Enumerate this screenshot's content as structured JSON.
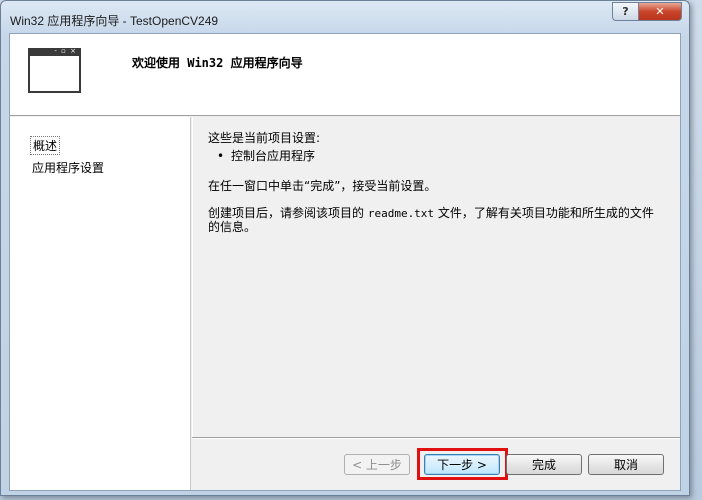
{
  "window": {
    "title": "Win32 应用程序向导 - TestOpenCV249",
    "help_label": "?",
    "close_label": "✕"
  },
  "banner": {
    "title": "欢迎使用 Win32 应用程序向导",
    "icon": "window-icon"
  },
  "nav": {
    "items": [
      {
        "label": "概述"
      },
      {
        "label": "应用程序设置"
      }
    ]
  },
  "content": {
    "intro": "这些是当前项目设置:",
    "bullet": "控制台应用程序",
    "finish_hint": "在任一窗口中单击“完成”，接受当前设置。",
    "readme_before": "创建项目后，请参阅该项目的 ",
    "readme_file": "readme.txt",
    "readme_after": " 文件，了解有关项目功能和所生成的文件",
    "readme_line2": "的信息。"
  },
  "buttons": {
    "prev": "< 上一步",
    "next": "下一步 >",
    "finish": "完成",
    "cancel": "取消"
  },
  "colors": {
    "highlight": "#e01010",
    "default_button_border": "#3c7fb1"
  }
}
